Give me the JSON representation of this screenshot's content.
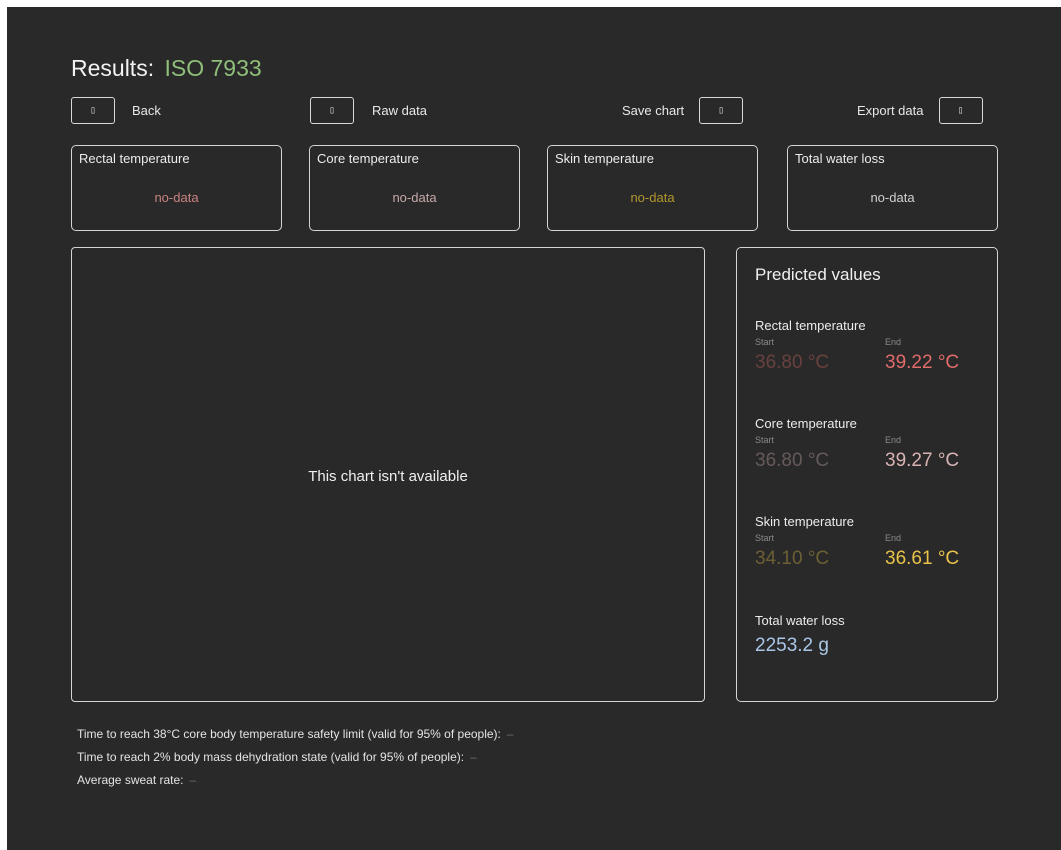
{
  "header": {
    "title": "Results:",
    "standard": "ISO 7933"
  },
  "toolbar": {
    "back": {
      "icon": "▯",
      "label": "Back"
    },
    "raw": {
      "icon": "▯",
      "label": "Raw data"
    },
    "save": {
      "icon": "▯",
      "label": "Save chart"
    },
    "export": {
      "icon": "▯",
      "label": "Export data"
    }
  },
  "cards": [
    {
      "label": "Rectal temperature",
      "value": "no-data",
      "color": "#c98282"
    },
    {
      "label": "Core temperature",
      "value": "no-data",
      "color": "#c7a9a9"
    },
    {
      "label": "Skin temperature",
      "value": "no-data",
      "color": "#b3962d"
    },
    {
      "label": "Total water loss",
      "value": "no-data",
      "color": "#d0d0d0"
    }
  ],
  "chart": {
    "message": "This chart isn't available"
  },
  "predicted": {
    "title": "Predicted values",
    "rectal": {
      "label": "Rectal temperature",
      "start_caption": "Start",
      "end_caption": "End",
      "start": "36.80 °C",
      "end": "39.22 °C",
      "color": "#e06b6b"
    },
    "core": {
      "label": "Core temperature",
      "start_caption": "Start",
      "end_caption": "End",
      "start": "36.80 °C",
      "end": "39.27 °C",
      "color": "#d9b3b3"
    },
    "skin": {
      "label": "Skin temperature",
      "start_caption": "Start",
      "end_caption": "End",
      "start": "34.10 °C",
      "end": "36.61 °C",
      "color": "#e8c34a"
    },
    "water": {
      "label": "Total water loss",
      "value": "2253.2 g",
      "color": "#a9c6e6"
    }
  },
  "footer": [
    {
      "text": "Time to reach 38°C core body temperature safety limit (valid for 95% of people):",
      "value": "–"
    },
    {
      "text": "Time to reach 2% body mass dehydration state (valid for 95% of people):",
      "value": "–"
    },
    {
      "text": "Average sweat rate:",
      "value": "–"
    }
  ]
}
